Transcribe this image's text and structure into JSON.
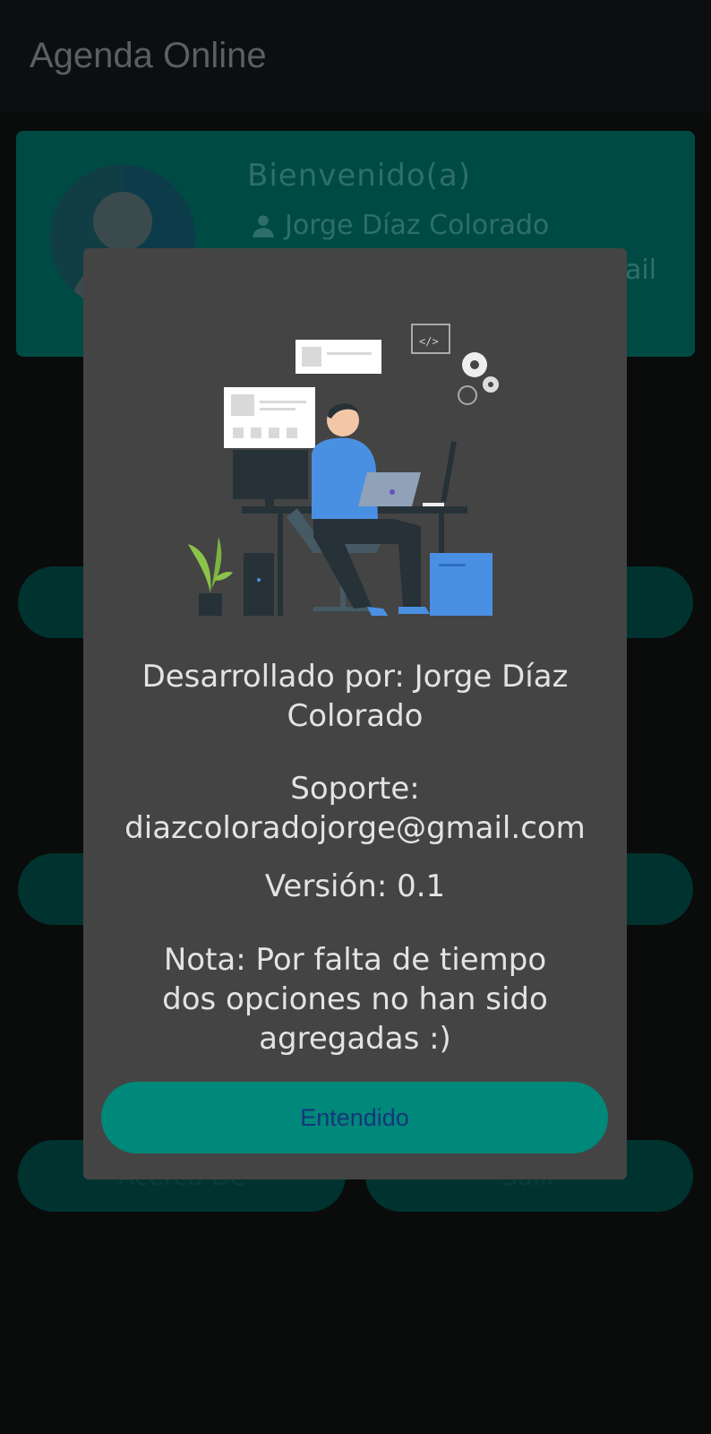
{
  "app": {
    "title": "Agenda Online"
  },
  "profile": {
    "welcome": "Bienvenido(a)",
    "user_name": "Jorge Díaz Colorado",
    "email_fragment": "ail"
  },
  "background_buttons": {
    "about_label": "Acerca De",
    "exit_label": "Salir"
  },
  "dialog": {
    "developer": "Desarrollado por: Jorge Díaz Colorado",
    "support_label": "Soporte:",
    "support_email": "diazcoloradojorge@gmail.com",
    "version": "Versión: 0.1",
    "note": "Nota: Por falta de tiempo dos opciones no han sido agregadas :)",
    "ok_button": "Entendido"
  },
  "colors": {
    "accent": "#00887a",
    "dialog_bg": "#444444",
    "scrim_bg": "#0a0b0b"
  }
}
